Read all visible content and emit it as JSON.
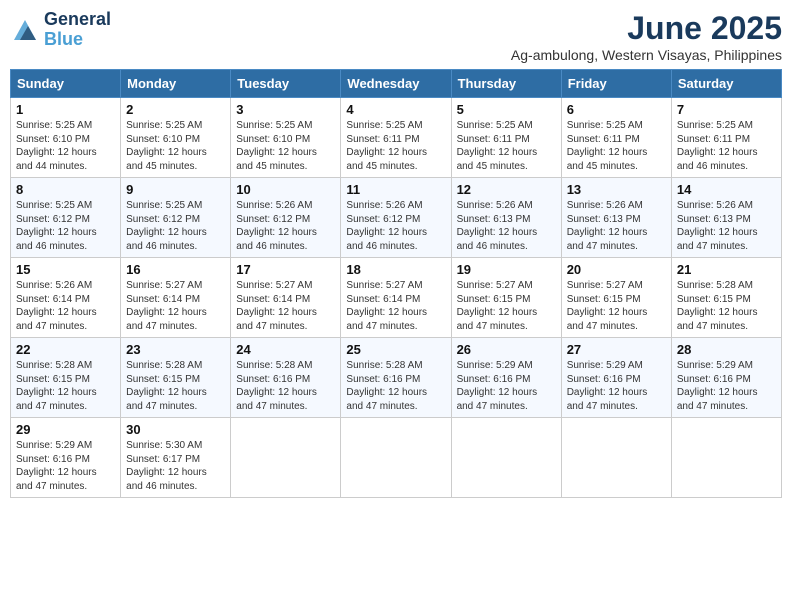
{
  "header": {
    "logo_line1": "General",
    "logo_line2": "Blue",
    "month": "June 2025",
    "location": "Ag-ambulong, Western Visayas, Philippines"
  },
  "weekdays": [
    "Sunday",
    "Monday",
    "Tuesday",
    "Wednesday",
    "Thursday",
    "Friday",
    "Saturday"
  ],
  "weeks": [
    [
      {
        "day": "1",
        "info": "Sunrise: 5:25 AM\nSunset: 6:10 PM\nDaylight: 12 hours\nand 44 minutes."
      },
      {
        "day": "2",
        "info": "Sunrise: 5:25 AM\nSunset: 6:10 PM\nDaylight: 12 hours\nand 45 minutes."
      },
      {
        "day": "3",
        "info": "Sunrise: 5:25 AM\nSunset: 6:10 PM\nDaylight: 12 hours\nand 45 minutes."
      },
      {
        "day": "4",
        "info": "Sunrise: 5:25 AM\nSunset: 6:11 PM\nDaylight: 12 hours\nand 45 minutes."
      },
      {
        "day": "5",
        "info": "Sunrise: 5:25 AM\nSunset: 6:11 PM\nDaylight: 12 hours\nand 45 minutes."
      },
      {
        "day": "6",
        "info": "Sunrise: 5:25 AM\nSunset: 6:11 PM\nDaylight: 12 hours\nand 45 minutes."
      },
      {
        "day": "7",
        "info": "Sunrise: 5:25 AM\nSunset: 6:11 PM\nDaylight: 12 hours\nand 46 minutes."
      }
    ],
    [
      {
        "day": "8",
        "info": "Sunrise: 5:25 AM\nSunset: 6:12 PM\nDaylight: 12 hours\nand 46 minutes."
      },
      {
        "day": "9",
        "info": "Sunrise: 5:25 AM\nSunset: 6:12 PM\nDaylight: 12 hours\nand 46 minutes."
      },
      {
        "day": "10",
        "info": "Sunrise: 5:26 AM\nSunset: 6:12 PM\nDaylight: 12 hours\nand 46 minutes."
      },
      {
        "day": "11",
        "info": "Sunrise: 5:26 AM\nSunset: 6:12 PM\nDaylight: 12 hours\nand 46 minutes."
      },
      {
        "day": "12",
        "info": "Sunrise: 5:26 AM\nSunset: 6:13 PM\nDaylight: 12 hours\nand 46 minutes."
      },
      {
        "day": "13",
        "info": "Sunrise: 5:26 AM\nSunset: 6:13 PM\nDaylight: 12 hours\nand 47 minutes."
      },
      {
        "day": "14",
        "info": "Sunrise: 5:26 AM\nSunset: 6:13 PM\nDaylight: 12 hours\nand 47 minutes."
      }
    ],
    [
      {
        "day": "15",
        "info": "Sunrise: 5:26 AM\nSunset: 6:14 PM\nDaylight: 12 hours\nand 47 minutes."
      },
      {
        "day": "16",
        "info": "Sunrise: 5:27 AM\nSunset: 6:14 PM\nDaylight: 12 hours\nand 47 minutes."
      },
      {
        "day": "17",
        "info": "Sunrise: 5:27 AM\nSunset: 6:14 PM\nDaylight: 12 hours\nand 47 minutes."
      },
      {
        "day": "18",
        "info": "Sunrise: 5:27 AM\nSunset: 6:14 PM\nDaylight: 12 hours\nand 47 minutes."
      },
      {
        "day": "19",
        "info": "Sunrise: 5:27 AM\nSunset: 6:15 PM\nDaylight: 12 hours\nand 47 minutes."
      },
      {
        "day": "20",
        "info": "Sunrise: 5:27 AM\nSunset: 6:15 PM\nDaylight: 12 hours\nand 47 minutes."
      },
      {
        "day": "21",
        "info": "Sunrise: 5:28 AM\nSunset: 6:15 PM\nDaylight: 12 hours\nand 47 minutes."
      }
    ],
    [
      {
        "day": "22",
        "info": "Sunrise: 5:28 AM\nSunset: 6:15 PM\nDaylight: 12 hours\nand 47 minutes."
      },
      {
        "day": "23",
        "info": "Sunrise: 5:28 AM\nSunset: 6:15 PM\nDaylight: 12 hours\nand 47 minutes."
      },
      {
        "day": "24",
        "info": "Sunrise: 5:28 AM\nSunset: 6:16 PM\nDaylight: 12 hours\nand 47 minutes."
      },
      {
        "day": "25",
        "info": "Sunrise: 5:28 AM\nSunset: 6:16 PM\nDaylight: 12 hours\nand 47 minutes."
      },
      {
        "day": "26",
        "info": "Sunrise: 5:29 AM\nSunset: 6:16 PM\nDaylight: 12 hours\nand 47 minutes."
      },
      {
        "day": "27",
        "info": "Sunrise: 5:29 AM\nSunset: 6:16 PM\nDaylight: 12 hours\nand 47 minutes."
      },
      {
        "day": "28",
        "info": "Sunrise: 5:29 AM\nSunset: 6:16 PM\nDaylight: 12 hours\nand 47 minutes."
      }
    ],
    [
      {
        "day": "29",
        "info": "Sunrise: 5:29 AM\nSunset: 6:16 PM\nDaylight: 12 hours\nand 47 minutes."
      },
      {
        "day": "30",
        "info": "Sunrise: 5:30 AM\nSunset: 6:17 PM\nDaylight: 12 hours\nand 46 minutes."
      },
      null,
      null,
      null,
      null,
      null
    ]
  ]
}
